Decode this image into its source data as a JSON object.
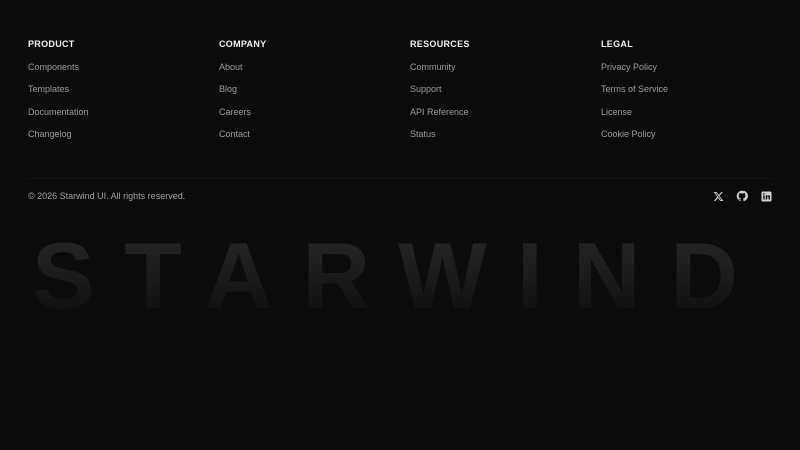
{
  "footer": {
    "columns": [
      {
        "title": "PRODUCT",
        "links": [
          "Components",
          "Templates",
          "Documentation",
          "Changelog"
        ]
      },
      {
        "title": "COMPANY",
        "links": [
          "About",
          "Blog",
          "Careers",
          "Contact"
        ]
      },
      {
        "title": "RESOURCES",
        "links": [
          "Community",
          "Support",
          "API Reference",
          "Status"
        ]
      },
      {
        "title": "LEGAL",
        "links": [
          "Privacy Policy",
          "Terms of Service",
          "License",
          "Cookie Policy"
        ]
      }
    ],
    "copyright": "© 2026 Starwind UI. All rights reserved.",
    "socials": [
      {
        "icon": "x-icon"
      },
      {
        "icon": "github-icon"
      },
      {
        "icon": "linkedin-icon"
      }
    ],
    "brand_wordmark": "STARWIND"
  },
  "colors": {
    "background": "#0b0b0b",
    "heading": "#f2f2f2",
    "link": "#9d9d9d",
    "icon": "#d0d0d0"
  }
}
